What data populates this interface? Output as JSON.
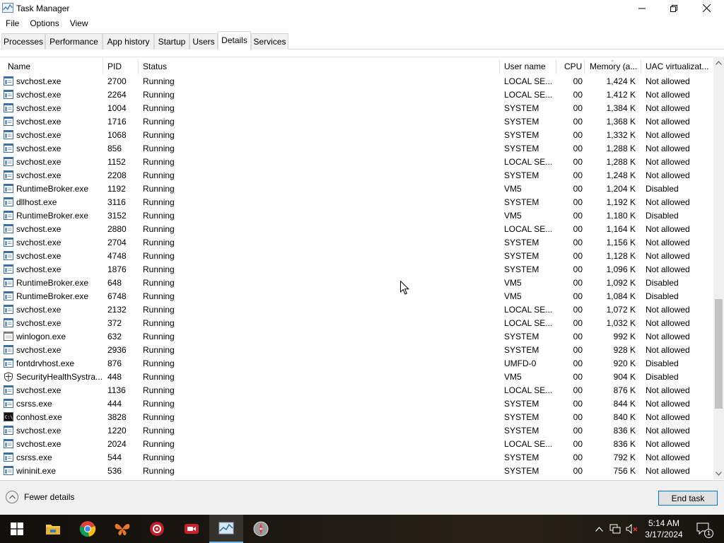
{
  "window": {
    "title": "Task Manager",
    "minimize_icon": "minimize-icon",
    "maximize_icon": "restore-icon",
    "close_icon": "close-icon"
  },
  "menu": [
    "File",
    "Options",
    "View"
  ],
  "tabs": [
    {
      "label": "Processes",
      "active": false
    },
    {
      "label": "Performance",
      "active": false
    },
    {
      "label": "App history",
      "active": false
    },
    {
      "label": "Startup",
      "active": false
    },
    {
      "label": "Users",
      "active": false
    },
    {
      "label": "Details",
      "active": true
    },
    {
      "label": "Services",
      "active": false
    }
  ],
  "columns": {
    "name": "Name",
    "pid": "PID",
    "status": "Status",
    "user": "User name",
    "cpu": "CPU",
    "memory": "Memory (a...",
    "uac": "UAC virtualizat..."
  },
  "rows": [
    {
      "icon": "service-host-icon",
      "name": "svchost.exe",
      "pid": "2700",
      "status": "Running",
      "user": "LOCAL SE...",
      "cpu": "00",
      "memory": "1,424 K",
      "uac": "Not allowed"
    },
    {
      "icon": "service-host-icon",
      "name": "svchost.exe",
      "pid": "2264",
      "status": "Running",
      "user": "LOCAL SE...",
      "cpu": "00",
      "memory": "1,412 K",
      "uac": "Not allowed"
    },
    {
      "icon": "service-host-icon",
      "name": "svchost.exe",
      "pid": "1004",
      "status": "Running",
      "user": "SYSTEM",
      "cpu": "00",
      "memory": "1,384 K",
      "uac": "Not allowed"
    },
    {
      "icon": "service-host-icon",
      "name": "svchost.exe",
      "pid": "1716",
      "status": "Running",
      "user": "SYSTEM",
      "cpu": "00",
      "memory": "1,368 K",
      "uac": "Not allowed"
    },
    {
      "icon": "service-host-icon",
      "name": "svchost.exe",
      "pid": "1068",
      "status": "Running",
      "user": "SYSTEM",
      "cpu": "00",
      "memory": "1,332 K",
      "uac": "Not allowed"
    },
    {
      "icon": "service-host-icon",
      "name": "svchost.exe",
      "pid": "856",
      "status": "Running",
      "user": "SYSTEM",
      "cpu": "00",
      "memory": "1,288 K",
      "uac": "Not allowed"
    },
    {
      "icon": "service-host-icon",
      "name": "svchost.exe",
      "pid": "1152",
      "status": "Running",
      "user": "LOCAL SE...",
      "cpu": "00",
      "memory": "1,288 K",
      "uac": "Not allowed"
    },
    {
      "icon": "service-host-icon",
      "name": "svchost.exe",
      "pid": "2208",
      "status": "Running",
      "user": "SYSTEM",
      "cpu": "00",
      "memory": "1,248 K",
      "uac": "Not allowed"
    },
    {
      "icon": "service-host-icon",
      "name": "RuntimeBroker.exe",
      "pid": "1192",
      "status": "Running",
      "user": "VM5",
      "cpu": "00",
      "memory": "1,204 K",
      "uac": "Disabled"
    },
    {
      "icon": "service-host-icon",
      "name": "dllhost.exe",
      "pid": "3116",
      "status": "Running",
      "user": "SYSTEM",
      "cpu": "00",
      "memory": "1,192 K",
      "uac": "Not allowed"
    },
    {
      "icon": "service-host-icon",
      "name": "RuntimeBroker.exe",
      "pid": "3152",
      "status": "Running",
      "user": "VM5",
      "cpu": "00",
      "memory": "1,180 K",
      "uac": "Disabled"
    },
    {
      "icon": "service-host-icon",
      "name": "svchost.exe",
      "pid": "2880",
      "status": "Running",
      "user": "LOCAL SE...",
      "cpu": "00",
      "memory": "1,164 K",
      "uac": "Not allowed"
    },
    {
      "icon": "service-host-icon",
      "name": "svchost.exe",
      "pid": "2704",
      "status": "Running",
      "user": "SYSTEM",
      "cpu": "00",
      "memory": "1,156 K",
      "uac": "Not allowed"
    },
    {
      "icon": "service-host-icon",
      "name": "svchost.exe",
      "pid": "4748",
      "status": "Running",
      "user": "SYSTEM",
      "cpu": "00",
      "memory": "1,128 K",
      "uac": "Not allowed"
    },
    {
      "icon": "service-host-icon",
      "name": "svchost.exe",
      "pid": "1876",
      "status": "Running",
      "user": "SYSTEM",
      "cpu": "00",
      "memory": "1,096 K",
      "uac": "Not allowed"
    },
    {
      "icon": "service-host-icon",
      "name": "RuntimeBroker.exe",
      "pid": "648",
      "status": "Running",
      "user": "VM5",
      "cpu": "00",
      "memory": "1,092 K",
      "uac": "Disabled"
    },
    {
      "icon": "service-host-icon",
      "name": "RuntimeBroker.exe",
      "pid": "6748",
      "status": "Running",
      "user": "VM5",
      "cpu": "00",
      "memory": "1,084 K",
      "uac": "Disabled"
    },
    {
      "icon": "service-host-icon",
      "name": "svchost.exe",
      "pid": "2132",
      "status": "Running",
      "user": "LOCAL SE...",
      "cpu": "00",
      "memory": "1,072 K",
      "uac": "Not allowed"
    },
    {
      "icon": "service-host-icon",
      "name": "svchost.exe",
      "pid": "372",
      "status": "Running",
      "user": "LOCAL SE...",
      "cpu": "00",
      "memory": "1,032 K",
      "uac": "Not allowed"
    },
    {
      "icon": "window-app-icon",
      "name": "winlogon.exe",
      "pid": "632",
      "status": "Running",
      "user": "SYSTEM",
      "cpu": "00",
      "memory": "992 K",
      "uac": "Not allowed"
    },
    {
      "icon": "service-host-icon",
      "name": "svchost.exe",
      "pid": "2936",
      "status": "Running",
      "user": "SYSTEM",
      "cpu": "00",
      "memory": "928 K",
      "uac": "Not allowed"
    },
    {
      "icon": "service-host-icon",
      "name": "fontdrvhost.exe",
      "pid": "876",
      "status": "Running",
      "user": "UMFD-0",
      "cpu": "00",
      "memory": "920 K",
      "uac": "Disabled"
    },
    {
      "icon": "shield-icon",
      "name": "SecurityHealthSystra...",
      "pid": "448",
      "status": "Running",
      "user": "VM5",
      "cpu": "00",
      "memory": "904 K",
      "uac": "Disabled"
    },
    {
      "icon": "service-host-icon",
      "name": "svchost.exe",
      "pid": "1136",
      "status": "Running",
      "user": "LOCAL SE...",
      "cpu": "00",
      "memory": "876 K",
      "uac": "Not allowed"
    },
    {
      "icon": "service-host-icon",
      "name": "csrss.exe",
      "pid": "444",
      "status": "Running",
      "user": "SYSTEM",
      "cpu": "00",
      "memory": "844 K",
      "uac": "Not allowed"
    },
    {
      "icon": "console-icon",
      "name": "conhost.exe",
      "pid": "3828",
      "status": "Running",
      "user": "SYSTEM",
      "cpu": "00",
      "memory": "840 K",
      "uac": "Not allowed"
    },
    {
      "icon": "service-host-icon",
      "name": "svchost.exe",
      "pid": "1220",
      "status": "Running",
      "user": "SYSTEM",
      "cpu": "00",
      "memory": "836 K",
      "uac": "Not allowed"
    },
    {
      "icon": "service-host-icon",
      "name": "svchost.exe",
      "pid": "2024",
      "status": "Running",
      "user": "LOCAL SE...",
      "cpu": "00",
      "memory": "836 K",
      "uac": "Not allowed"
    },
    {
      "icon": "service-host-icon",
      "name": "csrss.exe",
      "pid": "544",
      "status": "Running",
      "user": "SYSTEM",
      "cpu": "00",
      "memory": "792 K",
      "uac": "Not allowed"
    },
    {
      "icon": "service-host-icon",
      "name": "wininit.exe",
      "pid": "536",
      "status": "Running",
      "user": "SYSTEM",
      "cpu": "00",
      "memory": "756 K",
      "uac": "Not allowed"
    }
  ],
  "footer": {
    "fewer_details": "Fewer details",
    "end_task": "End task"
  },
  "taskbar": {
    "items": [
      "start-icon",
      "file-explorer-icon",
      "chrome-icon",
      "butterfly-app-icon",
      "red-gear-app-icon",
      "camera-recorder-icon",
      "task-manager-icon",
      "compass-app-icon"
    ],
    "active": "task-manager-icon",
    "time": "5:14 AM",
    "date": "3/17/2024",
    "notification_count": "1"
  },
  "colors": {
    "accent": "#0078d7",
    "taskbar": "#1b1712",
    "selected_tab_border": "#d9d9d9"
  }
}
